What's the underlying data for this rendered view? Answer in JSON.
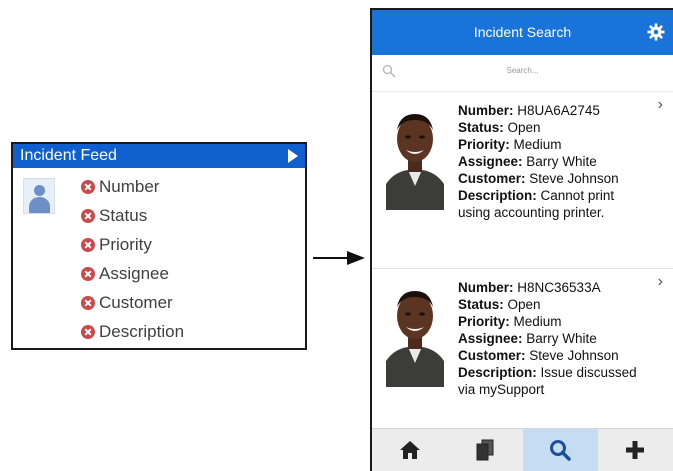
{
  "feed": {
    "title": "Incident Feed",
    "fields": [
      "Number",
      "Status",
      "Priority",
      "Assignee",
      "Customer",
      "Description"
    ],
    "header_color": "#0f5fcf",
    "remove_icon_color": "#c94a4a"
  },
  "phone": {
    "header": {
      "title": "Incident Search",
      "color": "#1a73d9"
    },
    "search": {
      "placeholder": "Search..."
    },
    "results": [
      {
        "number_label": "Number:",
        "number": "H8UA6A2745",
        "status_label": "Status:",
        "status": "Open",
        "priority_label": "Priority:",
        "priority": "Medium",
        "assignee_label": "Assignee:",
        "assignee": "Barry White",
        "customer_label": "Customer:",
        "customer": "Steve Johnson",
        "description_label": "Description:",
        "description": "Cannot print using accounting printer."
      },
      {
        "number_label": "Number:",
        "number": "H8NC36533A",
        "status_label": "Status:",
        "status": "Open",
        "priority_label": "Priority:",
        "priority": "Medium",
        "assignee_label": "Assignee:",
        "assignee": "Barry White",
        "customer_label": "Customer:",
        "customer": "Steve Johnson",
        "description_label": "Description:",
        "description": "Issue discussed via mySupport"
      }
    ],
    "tabs": [
      {
        "icon": "home-icon",
        "active": false
      },
      {
        "icon": "documents-icon",
        "active": false
      },
      {
        "icon": "search-icon",
        "active": true
      },
      {
        "icon": "add-icon",
        "active": false
      }
    ]
  }
}
